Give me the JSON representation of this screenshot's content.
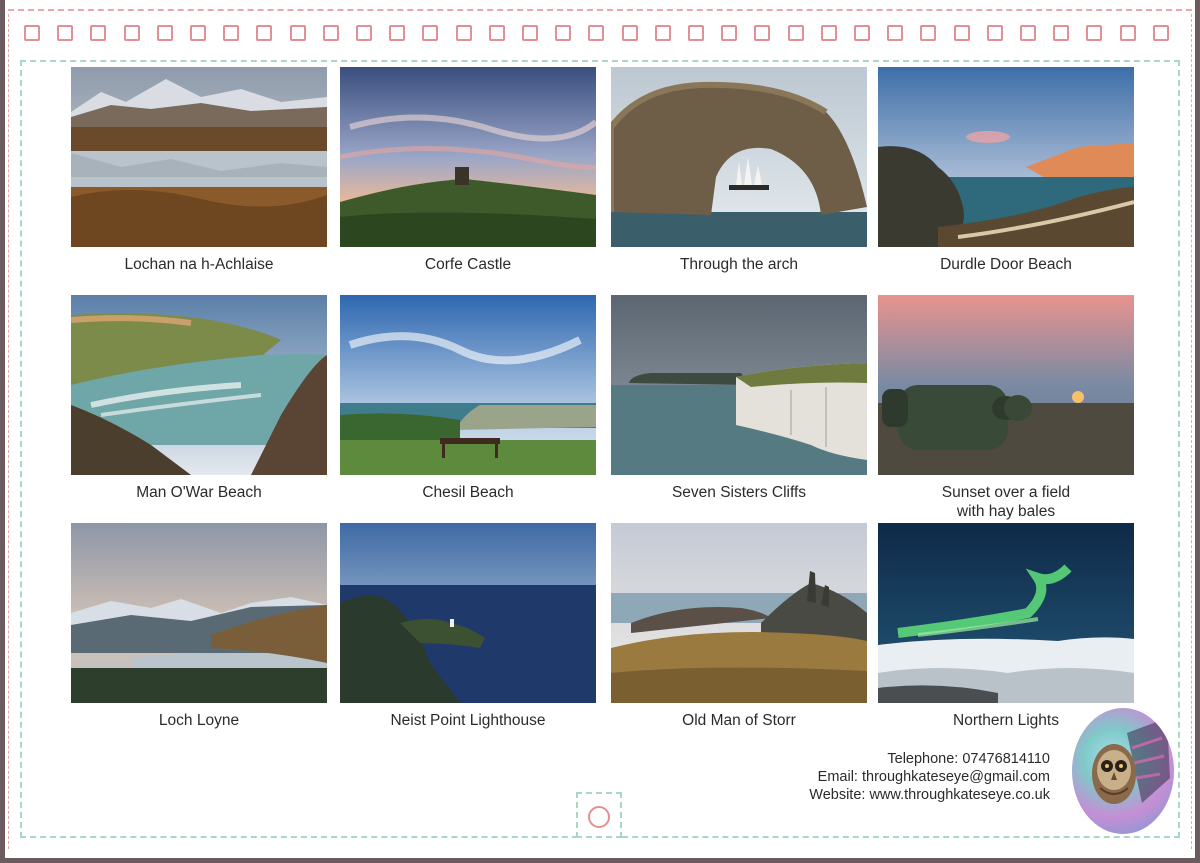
{
  "photos": [
    {
      "caption": "Lochan na h-Achlaise",
      "scene": "mountain-loch"
    },
    {
      "caption": "Corfe Castle",
      "scene": "castle-sunset"
    },
    {
      "caption": "Through the arch",
      "scene": "sea-arch"
    },
    {
      "caption": "Durdle Door Beach",
      "scene": "beach-cliffs"
    },
    {
      "caption": "Man O'War Beach",
      "scene": "bay"
    },
    {
      "caption": "Chesil Beach",
      "scene": "bench-view"
    },
    {
      "caption": "Seven Sisters Cliffs",
      "scene": "chalk-cliffs"
    },
    {
      "caption": "Sunset over a field\nwith hay bales",
      "scene": "hay-bales"
    },
    {
      "caption": "Loch Loyne",
      "scene": "loch-mountains"
    },
    {
      "caption": "Neist Point Lighthouse",
      "scene": "lighthouse"
    },
    {
      "caption": "Old Man of Storr",
      "scene": "storr"
    },
    {
      "caption": "Northern Lights",
      "scene": "aurora"
    }
  ],
  "contact": {
    "telephone": "Telephone: 07476814110",
    "email": "Email: throughkateseye@gmail.com",
    "website": "Website: www.throughkateseye.co.uk"
  },
  "logo": {
    "icon": "owl-icon"
  },
  "colors": {
    "hole_pink": "#e48f95",
    "dash_green": "#a8d8c4",
    "frame": "#6b5a5e"
  }
}
